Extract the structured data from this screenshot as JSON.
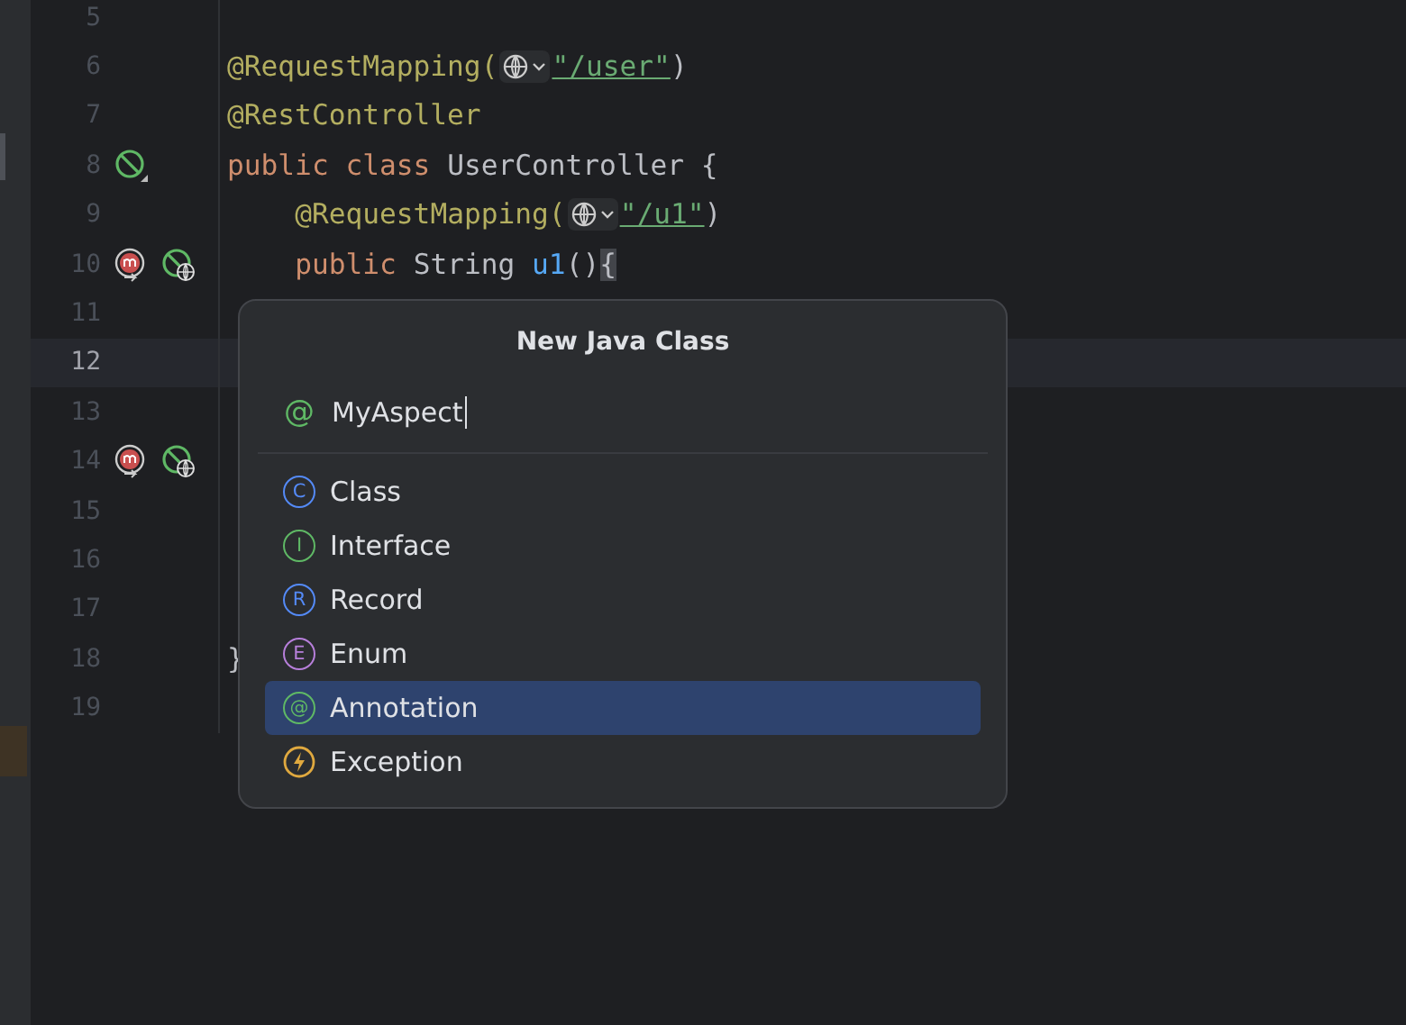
{
  "editor": {
    "lines": [
      {
        "number": "5",
        "current": false
      },
      {
        "number": "6",
        "current": false,
        "tokens": [
          {
            "kind": "annotation",
            "text": "@RequestMapping("
          },
          {
            "kind": "hint"
          },
          {
            "kind": "string",
            "text": "\"/user\""
          },
          {
            "kind": "plain",
            "text": ")"
          }
        ]
      },
      {
        "number": "7",
        "current": false,
        "tokens": [
          {
            "kind": "annotation",
            "text": "@RestController"
          }
        ]
      },
      {
        "number": "8",
        "current": false,
        "icons": [
          {
            "kind": "bean"
          }
        ],
        "tokens": [
          {
            "kind": "keyword",
            "text": "public class "
          },
          {
            "kind": "plain",
            "text": "UserController {"
          }
        ]
      },
      {
        "number": "9",
        "current": false,
        "tokens": [
          {
            "kind": "indent"
          },
          {
            "kind": "annotation",
            "text": "@RequestMapping("
          },
          {
            "kind": "hint"
          },
          {
            "kind": "string",
            "text": "\"/u1\""
          },
          {
            "kind": "plain",
            "text": ")"
          }
        ]
      },
      {
        "number": "10",
        "current": false,
        "icons": [
          {
            "kind": "method"
          },
          {
            "kind": "endpoint"
          }
        ],
        "tokens": [
          {
            "kind": "indent"
          },
          {
            "kind": "keyword",
            "text": "public "
          },
          {
            "kind": "plain",
            "text": "String "
          },
          {
            "kind": "method",
            "text": "u1"
          },
          {
            "kind": "plain",
            "text": "()"
          },
          {
            "kind": "brace",
            "text": "{"
          }
        ]
      },
      {
        "number": "11",
        "current": false
      },
      {
        "number": "12",
        "current": true
      },
      {
        "number": "13",
        "current": false
      },
      {
        "number": "14",
        "current": false,
        "icons": [
          {
            "kind": "method"
          },
          {
            "kind": "endpoint"
          }
        ]
      },
      {
        "number": "15",
        "current": false
      },
      {
        "number": "16",
        "current": false
      },
      {
        "number": "17",
        "current": false
      },
      {
        "number": "18",
        "current": false,
        "tokens": [
          {
            "kind": "plain",
            "text": "}"
          }
        ]
      },
      {
        "number": "19",
        "current": false
      }
    ]
  },
  "dialog": {
    "title": "New Java Class",
    "name_field": {
      "badge": "@",
      "value": "MyAspect"
    },
    "items": [
      {
        "kind": "letter",
        "badge": "C",
        "color": "#548af7",
        "label": "Class",
        "selected": false
      },
      {
        "kind": "letter",
        "badge": "I",
        "color": "#5fb865",
        "label": "Interface",
        "selected": false
      },
      {
        "kind": "letter",
        "badge": "R",
        "color": "#548af7",
        "label": "Record",
        "selected": false
      },
      {
        "kind": "letter",
        "badge": "E",
        "color": "#b77fdb",
        "label": "Enum",
        "selected": false
      },
      {
        "kind": "letter",
        "badge": "@",
        "color": "#5fb865",
        "label": "Annotation",
        "selected": true
      },
      {
        "kind": "bolt",
        "color": "#e0a93f",
        "label": "Exception",
        "selected": false
      }
    ]
  }
}
